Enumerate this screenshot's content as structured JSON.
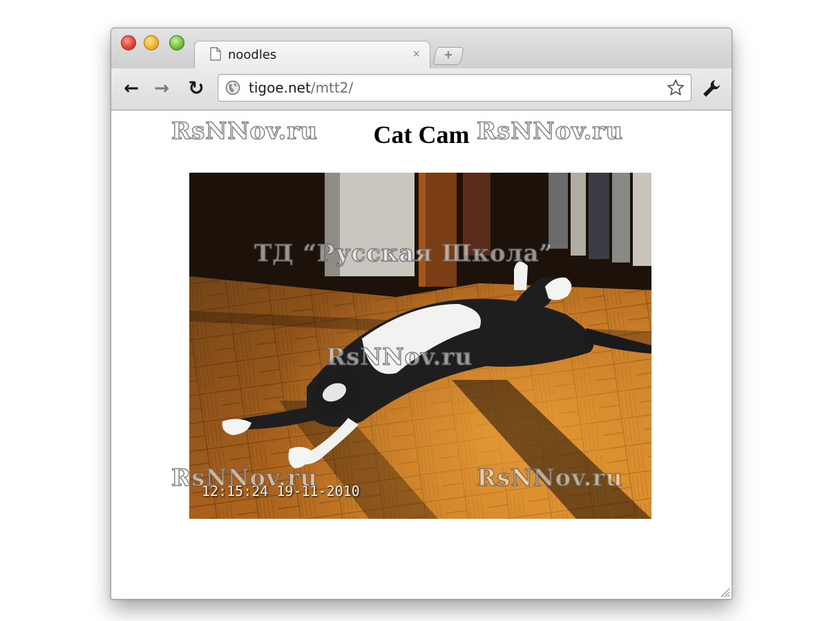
{
  "browser": {
    "tab": {
      "title": "noodles",
      "close_symbol": "×"
    },
    "new_tab_symbol": "+",
    "nav": {
      "back_symbol": "←",
      "forward_symbol": "→",
      "reload_symbol": "↻"
    },
    "address": {
      "host": "tigoe.net",
      "path": "/mtt2/"
    },
    "icons": [
      "page-icon",
      "globe-icon",
      "star-icon",
      "wrench-icon"
    ]
  },
  "page": {
    "title": "Cat Cam",
    "camera": {
      "timestamp": "12:15:24 19-11-2010"
    }
  },
  "watermarks": {
    "site": "RsNNov.ru",
    "publisher": "ТД “Русская Школа”"
  },
  "colors": {
    "close": "#e0443a",
    "minimize": "#f1b52d",
    "zoom": "#6fc140"
  }
}
